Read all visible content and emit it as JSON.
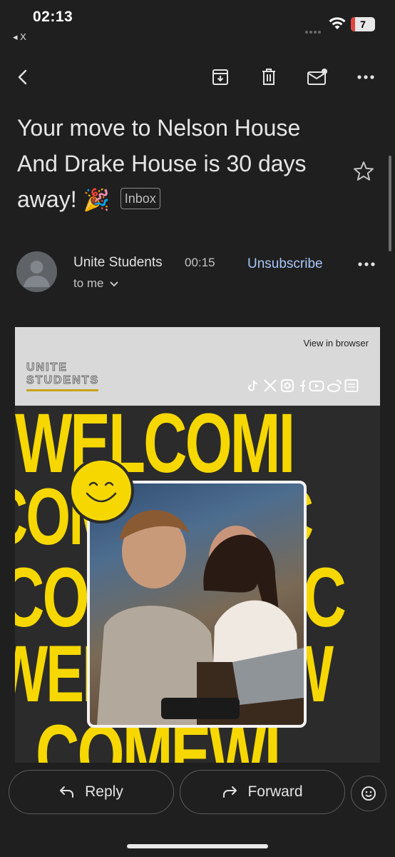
{
  "status_bar": {
    "time": "02:13",
    "back_app": "◂ X",
    "battery": "7"
  },
  "toolbar": {
    "back_icon": "arrow-left-icon",
    "archive_icon": "archive-icon",
    "delete_icon": "trash-icon",
    "mark_unread_icon": "mail-unread-icon",
    "more_icon": "more-horizontal-icon"
  },
  "email": {
    "subject": "Your move to Nelson House And Drake House is 30 days away!",
    "subject_emoji": "🎉",
    "label": "Inbox",
    "sender": "Unite Students",
    "time": "00:15",
    "recipient": "to me",
    "unsubscribe": "Unsubscribe"
  },
  "content": {
    "view_in_browser": "View in browser",
    "logo_line1": "UNITE",
    "logo_line2": "STUDENTS",
    "welcome_rows": [
      "WELCOMI",
      "COMEWELC",
      "COMEWELC",
      "WELCOMEW",
      "LCOMEWI"
    ],
    "accent": "#f6d800"
  },
  "actions": {
    "reply": "Reply",
    "forward": "Forward"
  }
}
